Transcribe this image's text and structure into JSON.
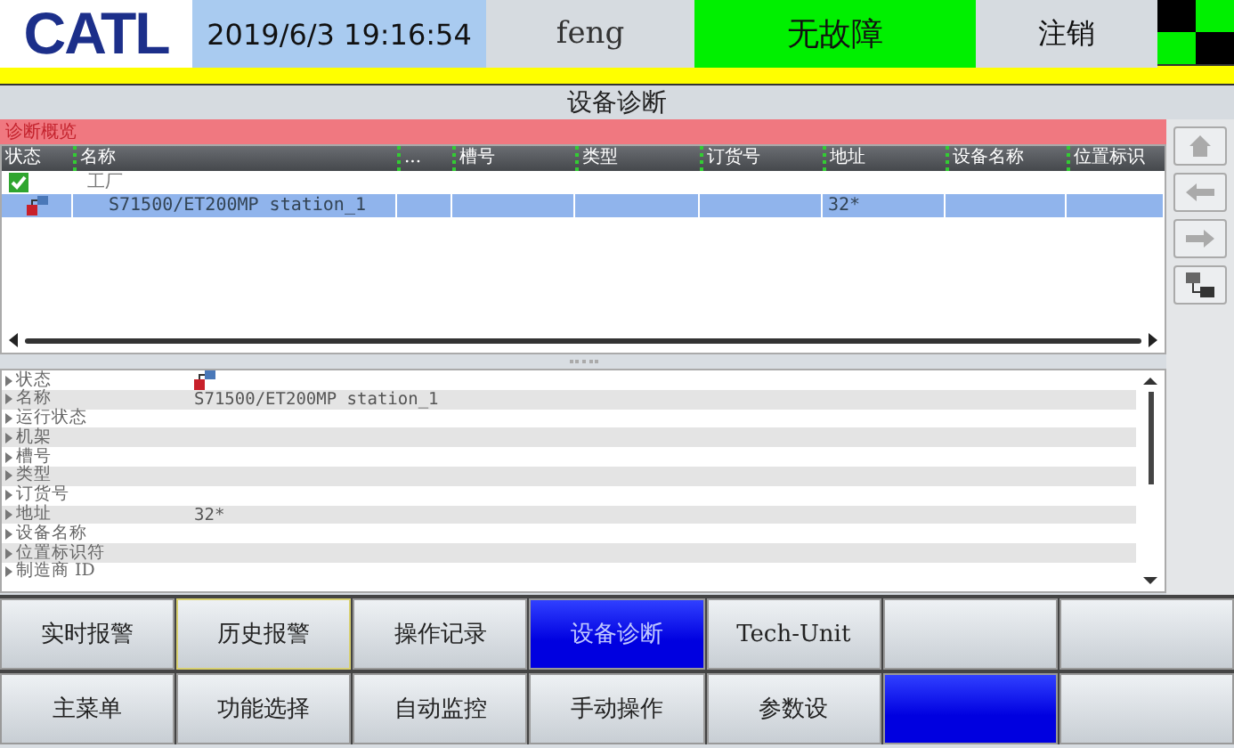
{
  "header": {
    "logo": "CATL",
    "datetime": "2019/6/3 19:16:54",
    "user": "feng",
    "status": "无故障",
    "logout": "注销"
  },
  "title": "设备诊断",
  "overview": {
    "title": "诊断概览",
    "columns": [
      "状态",
      "名称",
      "...",
      "槽号",
      "类型",
      "订货号",
      "地址",
      "设备名称",
      "位置标识"
    ],
    "rows": [
      {
        "kind": "ok",
        "name": "工厂",
        "selected": false,
        "children": [
          {
            "kind": "device",
            "name": "S71500/ET200MP station_1",
            "address": "32*",
            "selected": true
          }
        ]
      }
    ]
  },
  "details": [
    {
      "label": "状态",
      "kind": "device"
    },
    {
      "label": "名称",
      "value": "S71500/ET200MP station_1"
    },
    {
      "label": "运行状态"
    },
    {
      "label": "机架"
    },
    {
      "label": "槽号"
    },
    {
      "label": "类型"
    },
    {
      "label": "订货号"
    },
    {
      "label": "地址",
      "value": "32*"
    },
    {
      "label": "设备名称"
    },
    {
      "label": "位置标识符"
    },
    {
      "label": "制造商 ID"
    }
  ],
  "nav_rows": [
    [
      {
        "label": "实时报警",
        "selected": false,
        "focused": false
      },
      {
        "label": "历史报警",
        "selected": false,
        "focused": true
      },
      {
        "label": "操作记录",
        "selected": false,
        "focused": false
      },
      {
        "label": "设备诊断",
        "selected": true,
        "focused": false
      },
      {
        "label": "Tech-Unit",
        "selected": false,
        "focused": false
      },
      {
        "selected": false,
        "focused": false
      },
      {
        "selected": false,
        "focused": false
      }
    ],
    [
      {
        "label": "主菜单",
        "selected": false,
        "focused": false
      },
      {
        "label": "功能选择",
        "selected": false,
        "focused": false
      },
      {
        "label": "自动监控",
        "selected": false,
        "focused": false
      },
      {
        "label": "手动操作",
        "selected": false,
        "focused": false
      },
      {
        "label": "参数设",
        "selected": false,
        "focused": false
      },
      {
        "selected": true,
        "focused": false
      },
      {
        "selected": false,
        "focused": false
      }
    ]
  ]
}
